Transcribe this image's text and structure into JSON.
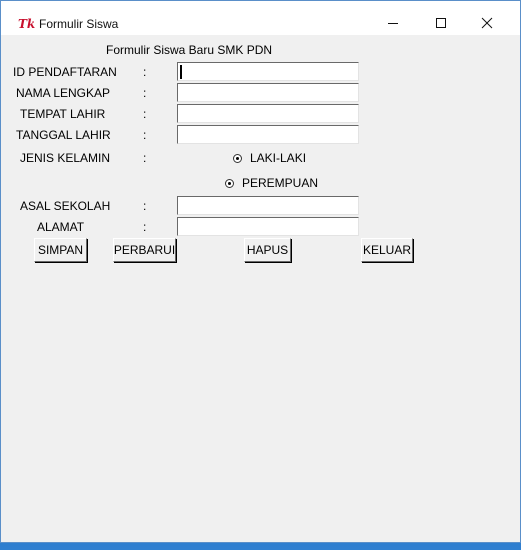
{
  "window": {
    "icon_text": "Tk",
    "title": "Formulir Siswa"
  },
  "form": {
    "heading": "Formulir Siswa Baru SMK PDN",
    "colon": ":",
    "labels": {
      "id": "ID PENDAFTARAN",
      "nama": "NAMA LENGKAP",
      "tempat": "TEMPAT LAHIR",
      "tanggal": "TANGGAL LAHIR",
      "jenis": "JENIS KELAMIN",
      "asal": "ASAL SEKOLAH",
      "alamat": "ALAMAT"
    },
    "radio": {
      "laki": "LAKI-LAKI",
      "perempuan": "PEREMPUAN"
    }
  },
  "buttons": {
    "simpan": "SIMPAN",
    "perbarui": "PERBARUI",
    "hapus": "HAPUS",
    "keluar": "KELUAR"
  }
}
